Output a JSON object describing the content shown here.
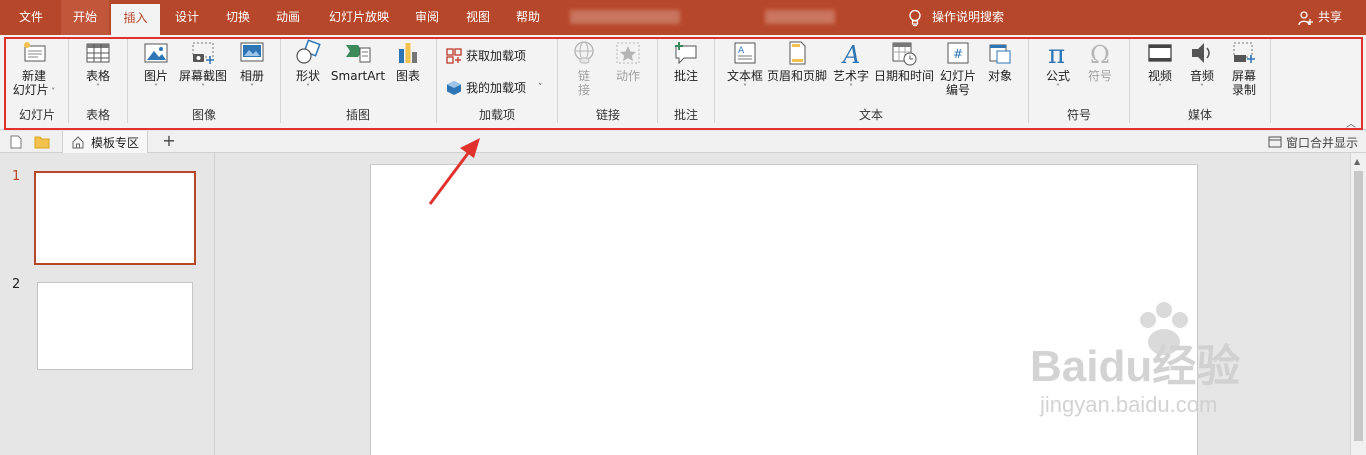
{
  "menu": {
    "tabs": [
      "文件",
      "开始",
      "插入",
      "设计",
      "切换",
      "动画",
      "幻灯片放映",
      "审阅",
      "视图",
      "帮助"
    ],
    "tellme": "操作说明搜索",
    "share": "共享"
  },
  "ribbon": {
    "groups": {
      "slides": {
        "label": "幻灯片",
        "new_slide_line1": "新建",
        "new_slide_line2": "幻灯片"
      },
      "tables": {
        "label": "表格",
        "table": "表格"
      },
      "images": {
        "label": "图像",
        "picture": "图片",
        "screenshot": "屏幕截图",
        "album": "相册"
      },
      "illustrations": {
        "label": "插图",
        "shapes": "形状",
        "smartart": "SmartArt",
        "chart": "图表"
      },
      "addins": {
        "label": "加载项",
        "get_addins": "获取加载项",
        "my_addins": "我的加载项"
      },
      "links": {
        "label": "链接",
        "link_line1": "链",
        "link_line2": "接",
        "action": "动作"
      },
      "comments": {
        "label": "批注",
        "comment": "批注"
      },
      "text": {
        "label": "文本",
        "textbox": "文本框",
        "header_footer": "页眉和页脚",
        "wordart": "艺术字",
        "datetime": "日期和时间",
        "slide_number_line1": "幻灯片",
        "slide_number_line2": "编号",
        "object": "对象"
      },
      "symbols": {
        "label": "符号",
        "equation": "公式",
        "symbol": "符号"
      },
      "media": {
        "label": "媒体",
        "video": "视频",
        "audio": "音频",
        "screen_record_line1": "屏幕",
        "screen_record_line2": "录制"
      }
    }
  },
  "docbar": {
    "tab_label": "模板专区",
    "merge_label": "窗口合并显示"
  },
  "slides": {
    "numbers": [
      "1",
      "2"
    ]
  },
  "watermark": {
    "brand": "Baidu经验",
    "url": "jingyan.baidu.com"
  },
  "colors": {
    "accent": "#b7472a",
    "highlight": "#e0312d"
  }
}
